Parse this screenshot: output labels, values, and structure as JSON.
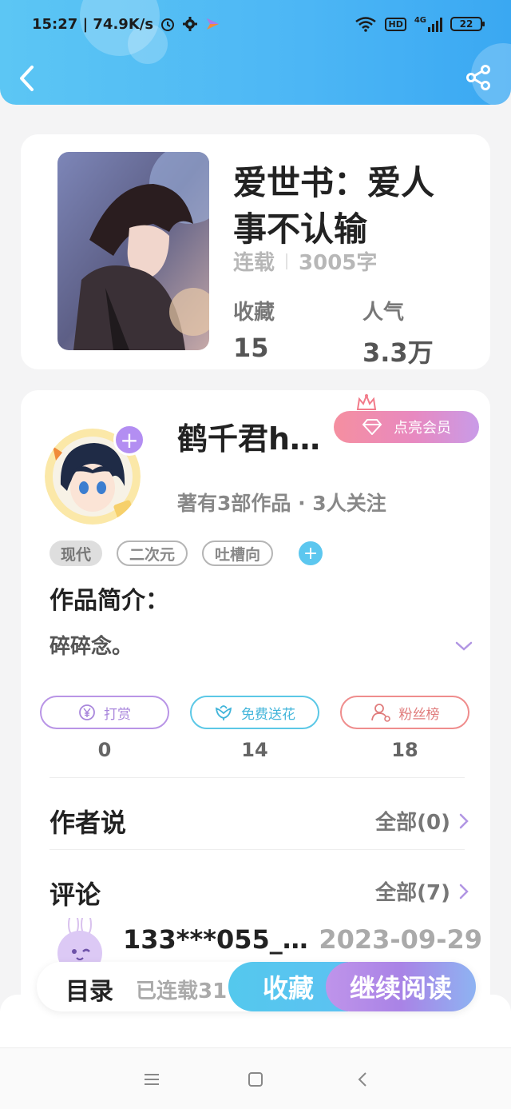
{
  "status_bar": {
    "time_speed": "15:27 | 74.9K/s",
    "battery": "22",
    "network": "4G",
    "hd": "HD"
  },
  "header": {
    "back_icon": "chevron-left-icon",
    "share_icon": "share-icon"
  },
  "book": {
    "title": "爱世书：爱人事不认输",
    "status": "连载",
    "word_count": "3005字",
    "favorites_label": "收藏",
    "favorites_value": "15",
    "popularity_label": "人气",
    "popularity_value": "3.3万"
  },
  "author": {
    "name": "鹤千君h…",
    "vip_label": "点亮会员",
    "meta": "著有3部作品 · 3人关注",
    "tags": [
      "现代",
      "二次元",
      "吐槽向"
    ],
    "intro_title": "作品简介：",
    "intro_text": "碎碎念。"
  },
  "actions": [
    {
      "label": "打赏",
      "count": "0",
      "icon": "yen-coin-icon"
    },
    {
      "label": "免费送花",
      "count": "14",
      "icon": "flower-icon"
    },
    {
      "label": "粉丝榜",
      "count": "18",
      "icon": "person-icon"
    }
  ],
  "sections": {
    "author_says": {
      "title": "作者说",
      "link": "全部(0)"
    },
    "comments": {
      "title": "评论",
      "link": "全部(7)"
    }
  },
  "comment": {
    "user": "133***055_…",
    "date": "2023-09-29"
  },
  "bottom_bar": {
    "catalog": "目录",
    "serial_info": "已连载31",
    "collect": "收藏",
    "continue_read": "继续阅读"
  },
  "colors": {
    "header_blue": "#4cb6f5",
    "purple": "#a987dc",
    "cyan": "#54c8ed",
    "pink": "#f58fa0"
  }
}
